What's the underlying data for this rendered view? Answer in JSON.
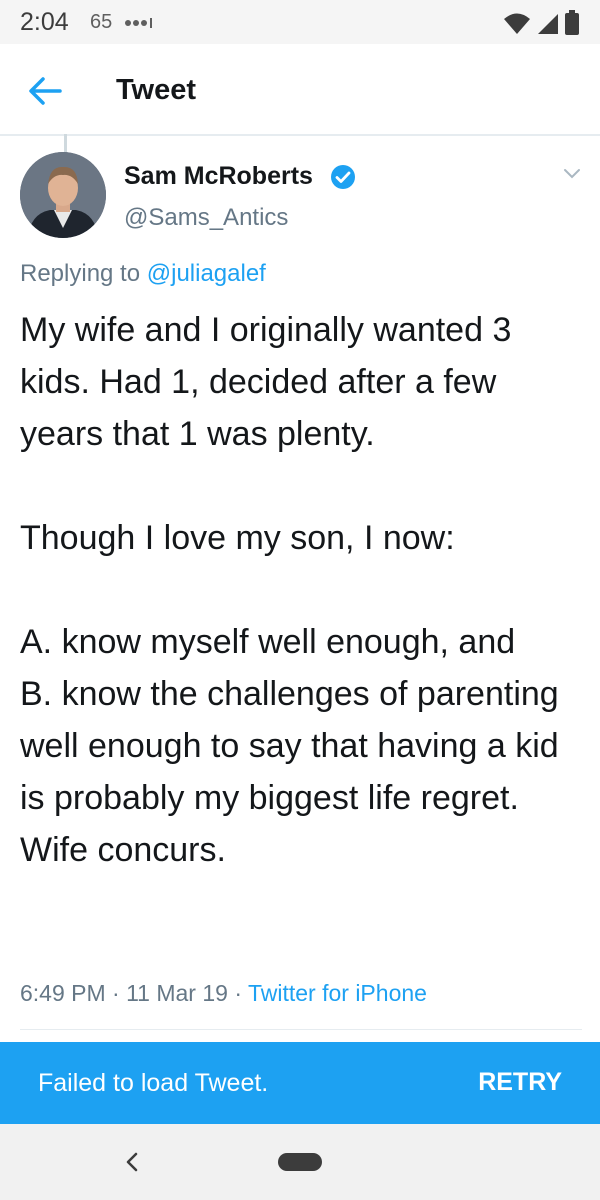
{
  "status_bar": {
    "time": "2:04",
    "badge": "65",
    "icons": [
      "signal-dots-icon",
      "wifi-icon",
      "cell-signal-icon",
      "battery-icon"
    ]
  },
  "header": {
    "back_icon": "back-arrow-icon",
    "title": "Tweet"
  },
  "tweet": {
    "author_name": "Sam McRoberts",
    "verified_icon": "verified-badge-icon",
    "handle": "@Sams_Antics",
    "menu_icon": "chevron-down-icon",
    "reply_prefix": "Replying to ",
    "reply_to": "@juliagalef",
    "text": "My wife and I originally wanted 3 kids. Had 1, decided after a few years that 1 was plenty.\n\nThough I love my son, I now:\n\nA. know myself well enough, and\nB. know the challenges of parenting well enough to say that having a kid is probably my biggest life regret. Wife concurs.",
    "timestamp": "6:49 PM · 11 Mar 19 · ",
    "source": "Twitter for iPhone"
  },
  "snackbar": {
    "message": "Failed to load Tweet.",
    "action": "RETRY"
  },
  "nav_bar": {
    "icons": [
      "back-chevron-icon",
      "home-pill-icon"
    ]
  },
  "colors": {
    "accent": "#1da1f2",
    "text": "#14171a",
    "secondary_text": "#657786"
  }
}
